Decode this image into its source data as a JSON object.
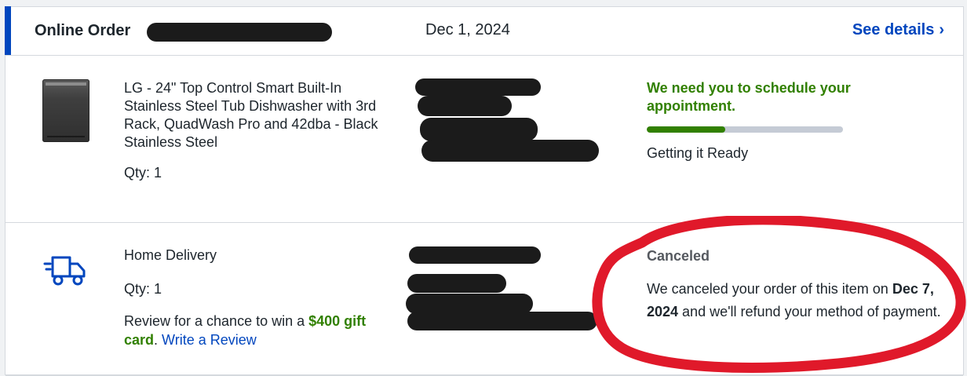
{
  "order": {
    "title": "Online Order",
    "date": "Dec 1, 2024",
    "see_details_label": "See details",
    "chevron": "›"
  },
  "item": {
    "image_icon": "dishwasher-image",
    "name": "LG - 24\" Top Control Smart Built-In Stainless Steel Tub Dishwasher with 3rd Rack, QuadWash Pro and 42dba - Black Stainless Steel",
    "qty": "Qty: 1",
    "status_heading": "We need you to schedule your appointment.",
    "progress": 0.4,
    "progress_label": "Getting it Ready"
  },
  "delivery": {
    "icon": "truck-icon",
    "label": "Home Delivery",
    "qty": "Qty: 1",
    "review_prefix": "Review for a chance to win a ",
    "review_prize": "$400 gift card",
    "review_suffix": ". ",
    "review_link": "Write a Review",
    "status": "Canceled",
    "message_prefix": "We canceled your order of this item on ",
    "message_date": "Dec 7, 2024",
    "message_suffix": " and we'll refund your method of payment."
  },
  "colors": {
    "accent": "#0046be",
    "green": "#318000",
    "circle_annotation": "#e0192a"
  }
}
